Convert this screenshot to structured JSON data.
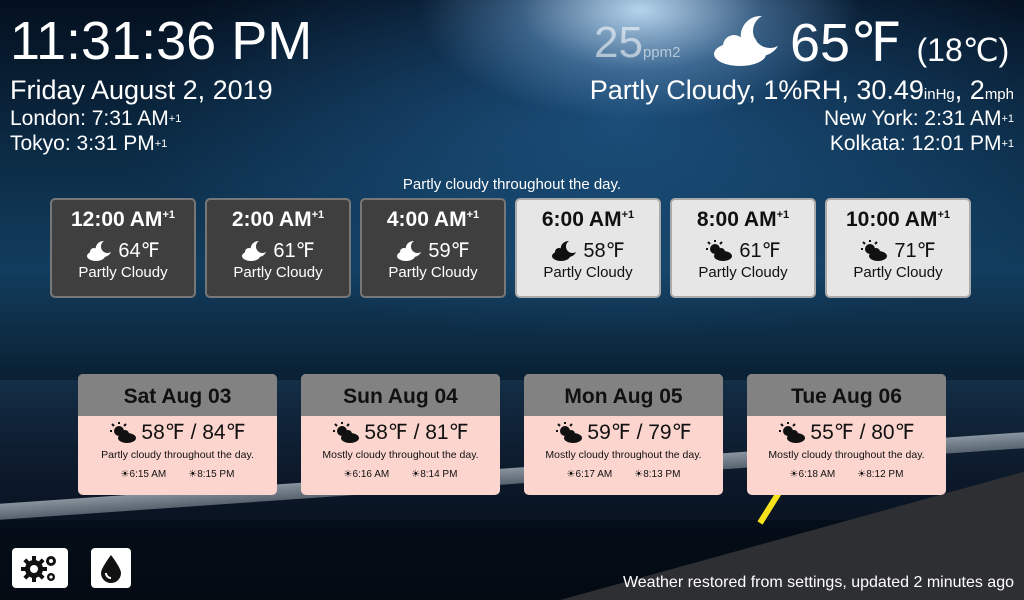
{
  "clock": {
    "time": "11:31:36 PM",
    "date": "Friday August 2, 2019"
  },
  "timezones": [
    {
      "text": "London: 7:31 AM",
      "sup": "+1"
    },
    {
      "text": "Tokyo: 3:31 PM",
      "sup": "+1"
    },
    {
      "text": "New York: 2:31 AM",
      "sup": "+1"
    },
    {
      "text": "Kolkata: 12:01 PM",
      "sup": "+1"
    }
  ],
  "current": {
    "aqi": "25",
    "aqi_unit": "ppm2",
    "temp": "65℉",
    "temp_c": "(18℃)",
    "condition": "Partly Cloudy, 1%RH, 30.49",
    "pressure_unit": "inHg",
    "wind": ", 2",
    "wind_unit": "mph",
    "icon": "partly-cloudy-night-icon"
  },
  "summary": "Partly cloudy throughout the day.",
  "hourly": [
    {
      "time": "12:00 AM",
      "sup": "+1",
      "temp": "64℉",
      "cond": "Partly Cloudy",
      "icon": "moon-cloud-icon"
    },
    {
      "time": "2:00 AM",
      "sup": "+1",
      "temp": "61℉",
      "cond": "Partly Cloudy",
      "icon": "moon-cloud-icon"
    },
    {
      "time": "4:00 AM",
      "sup": "+1",
      "temp": "59℉",
      "cond": "Partly Cloudy",
      "icon": "moon-cloud-icon"
    },
    {
      "time": "6:00 AM",
      "sup": "+1",
      "temp": "58℉",
      "cond": "Partly Cloudy",
      "icon": "moon-cloud-icon"
    },
    {
      "time": "8:00 AM",
      "sup": "+1",
      "temp": "61℉",
      "cond": "Partly Cloudy",
      "icon": "sun-cloud-icon"
    },
    {
      "time": "10:00 AM",
      "sup": "+1",
      "temp": "71℉",
      "cond": "Partly Cloudy",
      "icon": "sun-cloud-icon"
    }
  ],
  "daily": [
    {
      "day": "Sat Aug 03",
      "temps": "58℉ / 84℉",
      "desc": "Partly cloudy throughout the day.",
      "sunrise": "6:15 AM",
      "sunset": "8:15 PM"
    },
    {
      "day": "Sun Aug 04",
      "temps": "58℉ / 81℉",
      "desc": "Mostly cloudy throughout the day.",
      "sunrise": "6:16 AM",
      "sunset": "8:14 PM"
    },
    {
      "day": "Mon Aug 05",
      "temps": "59℉ / 79℉",
      "desc": "Mostly cloudy throughout the day.",
      "sunrise": "6:17 AM",
      "sunset": "8:13 PM"
    },
    {
      "day": "Tue Aug 06",
      "temps": "55℉ / 80℉",
      "desc": "Mostly cloudy throughout the day.",
      "sunrise": "6:18 AM",
      "sunset": "8:12 PM"
    }
  ],
  "buttons": {
    "settings_icon": "gears-icon",
    "water_icon": "water-drop-icon"
  },
  "status": "Weather restored from settings, updated 2 minutes ago",
  "colors": {
    "hour_dark": "#3f3f3f",
    "hour_light": "#e6e6e6",
    "day_card": "#fcd5cf",
    "day_header": "#828282"
  }
}
